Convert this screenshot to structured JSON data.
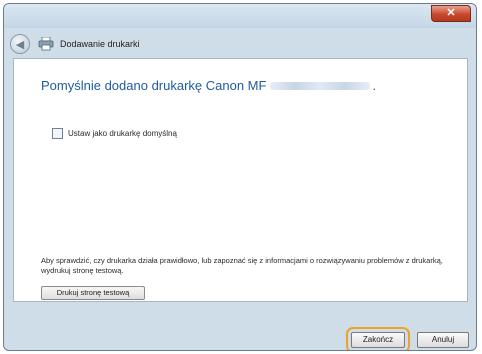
{
  "window": {
    "close_symbol": "✕",
    "title": "Dodawanie drukarki",
    "back_symbol": "◀"
  },
  "main": {
    "success_prefix": "Pomyślnie dodano drukarkę Canon MF",
    "success_suffix": ".",
    "default_printer_label": "Ustaw jako drukarkę domyślną",
    "test_info": "Aby sprawdzić, czy drukarka działa prawidłowo, lub zapoznać się z informacjami o rozwiązywaniu problemów z drukarką, wydrukuj stronę testową.",
    "test_button": "Drukuj stronę testową"
  },
  "footer": {
    "finish_button": "Zakończ",
    "cancel_button": "Anuluj"
  },
  "colors": {
    "title_blue": "#1f5b9e",
    "highlight": "#f0a12a"
  }
}
